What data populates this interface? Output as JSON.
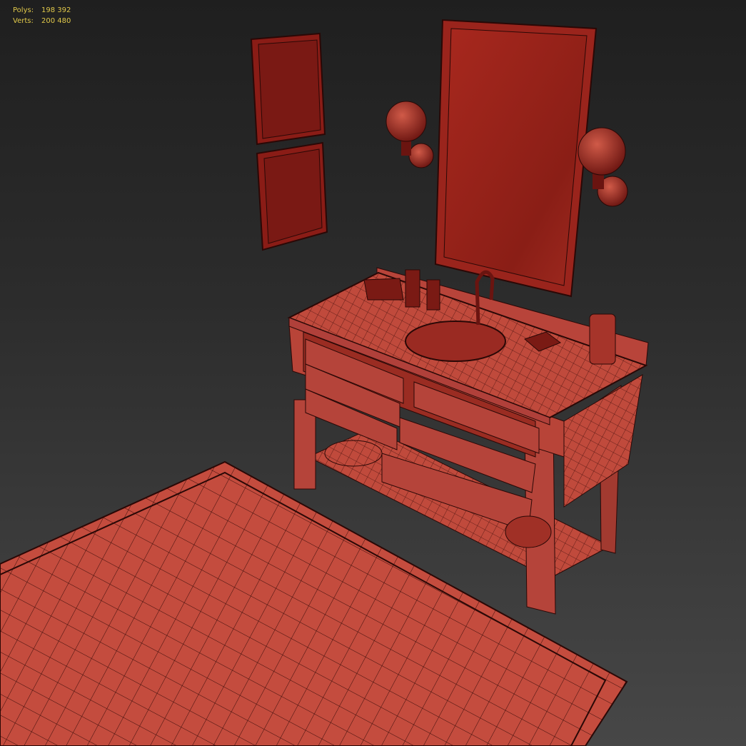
{
  "viewport": {
    "stats": [
      {
        "label": "Polys:",
        "value": "198 392"
      },
      {
        "label": "Verts:",
        "value": "200 480"
      }
    ]
  },
  "colors": {
    "mesh_fill": "#c24a3c",
    "mesh_dark": "#7a1a16",
    "wire": "#3a0d0a",
    "stats_text": "#e0c84a"
  }
}
